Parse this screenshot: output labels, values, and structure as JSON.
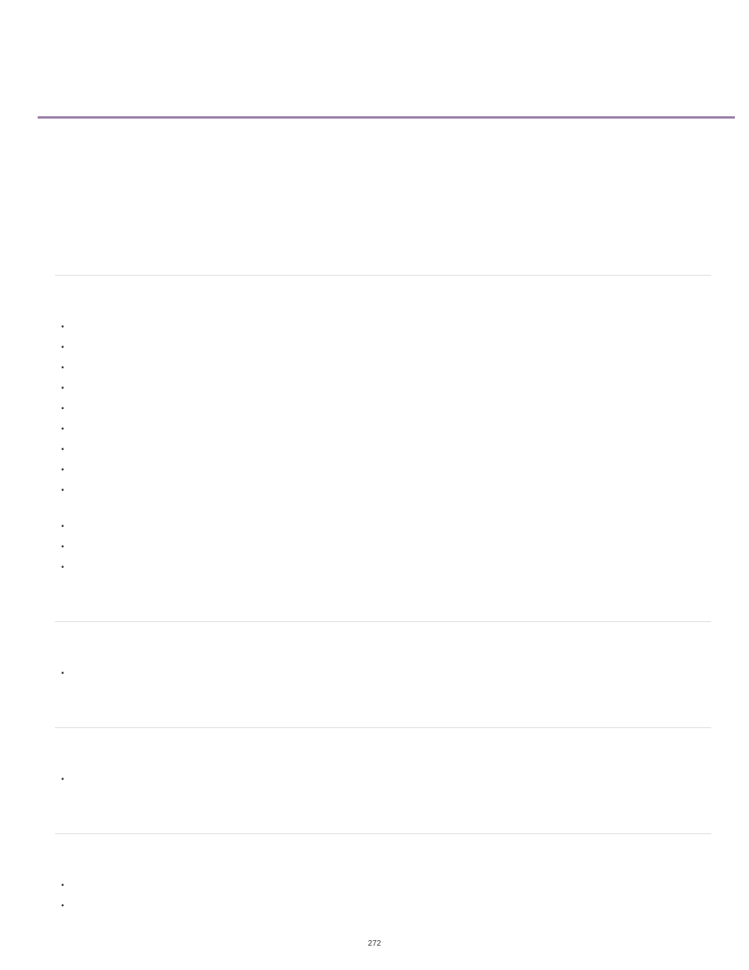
{
  "page_number": "272",
  "sections": [
    {
      "items": [
        "",
        "",
        "",
        "",
        "",
        "",
        "",
        "",
        ""
      ]
    },
    {
      "items_after_gap": [
        "",
        "",
        ""
      ]
    },
    {
      "items": [
        ""
      ]
    },
    {
      "items": [
        ""
      ]
    },
    {
      "items": [
        "",
        ""
      ]
    }
  ]
}
